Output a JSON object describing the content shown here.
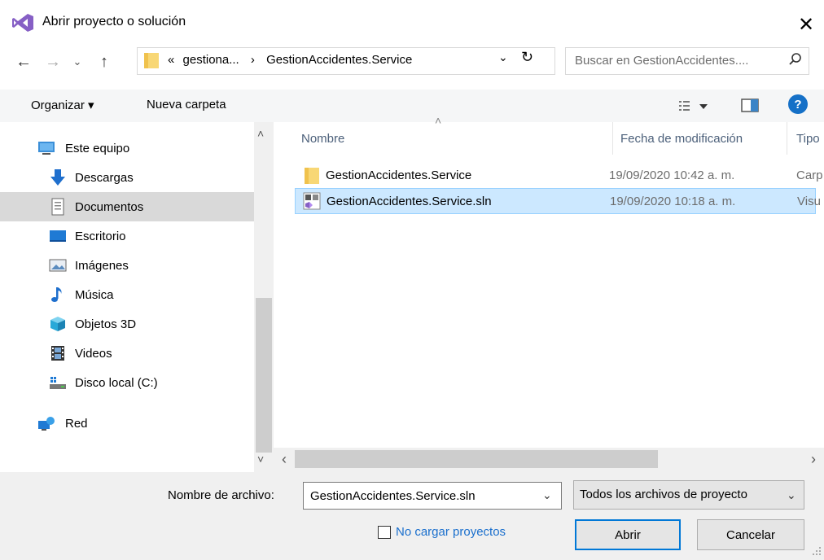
{
  "window": {
    "title": "Abrir proyecto o solución",
    "close_glyph": "✕",
    "icon": "visual-studio-logo"
  },
  "address": {
    "breadcrumb_prefix": "«",
    "crumb_parent": "gestiona...",
    "crumb_sep": "›",
    "crumb_current": "GestionAccidentes.Service",
    "search_placeholder": "Buscar en GestionAccidentes....",
    "back_glyph": "←",
    "forward_glyph": "→",
    "recent_glyph": "⌄",
    "up_glyph": "↑",
    "dropdown_glyph": "⌄",
    "refresh_glyph": "↻",
    "search_glyph": "⚲"
  },
  "toolbar": {
    "organize_label": "Organizar ▾",
    "new_folder_label": "Nueva carpeta",
    "help_label": "?"
  },
  "nav": {
    "items": [
      {
        "label": "Este equipo",
        "icon": "computer-icon"
      },
      {
        "label": "Descargas",
        "icon": "download-icon"
      },
      {
        "label": "Documentos",
        "icon": "documents-icon",
        "selected": true
      },
      {
        "label": "Escritorio",
        "icon": "desktop-icon"
      },
      {
        "label": "Imágenes",
        "icon": "pictures-icon"
      },
      {
        "label": "Música",
        "icon": "music-icon"
      },
      {
        "label": "Objetos 3D",
        "icon": "3d-objects-icon"
      },
      {
        "label": "Videos",
        "icon": "videos-icon"
      },
      {
        "label": "Disco local (C:)",
        "icon": "drive-icon"
      },
      {
        "label": "Red",
        "icon": "network-icon"
      }
    ],
    "scroll_up": "˄",
    "scroll_down": "˅"
  },
  "files": {
    "columns": [
      "Nombre",
      "Fecha de modificación",
      "Tipo"
    ],
    "sort_glyph": "˄",
    "rows": [
      {
        "name": "GestionAccidentes.Service",
        "date": "19/09/2020 10:42 a. m.",
        "type": "Carp",
        "icon": "folder-icon"
      },
      {
        "name": "GestionAccidentes.Service.sln",
        "date": "19/09/2020 10:18 a. m.",
        "type": "Visu",
        "icon": "solution-file-icon",
        "selected": true
      }
    ],
    "scroll_left": "‹",
    "scroll_right": "›"
  },
  "bottom": {
    "filename_label": "Nombre de archivo:",
    "filename_value": "GestionAccidentes.Service.sln",
    "filetype_value": "Todos los archivos de proyecto",
    "dropdown_glyph": "⌄",
    "checkbox_label": "No cargar proyectos",
    "checkbox_checked": false,
    "open_label": "Abrir",
    "cancel_label": "Cancelar"
  },
  "colors": {
    "accent": "#0078d7",
    "selection": "#cce8ff",
    "nav_selected": "#d9d9d9",
    "link": "#1a6fcd",
    "vs_purple": "#865fc5"
  }
}
